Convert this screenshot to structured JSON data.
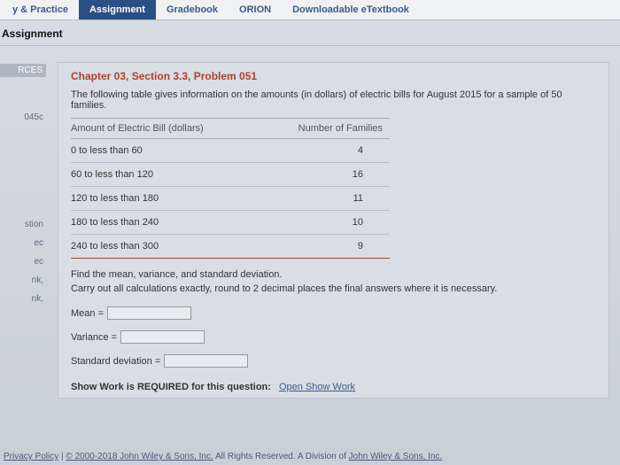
{
  "nav": {
    "items": [
      "y & Practice",
      "Assignment",
      "Gradebook",
      "ORION",
      "Downloadable eTextbook"
    ]
  },
  "page_header": "Assignment",
  "sidebar": {
    "rces": "RCES",
    "id": "045c",
    "stion": "stion",
    "ec": "ec",
    "nk": "nk,"
  },
  "problem": {
    "title": "Chapter 03, Section 3.3, Problem 051",
    "desc": "The following table gives information on the amounts (in dollars) of electric bills for August 2015 for a sample of 50 families.",
    "table": {
      "col1": "Amount of Electric Bill (dollars)",
      "col2": "Number of Families",
      "rows": [
        {
          "range": "0 to less than 60",
          "count": "4"
        },
        {
          "range": "60 to less than 120",
          "count": "16"
        },
        {
          "range": "120 to less than 180",
          "count": "11"
        },
        {
          "range": "180 to less than 240",
          "count": "10"
        },
        {
          "range": "240 to less than 300",
          "count": "9"
        }
      ]
    },
    "q1": "Find the mean, variance, and standard deviation.",
    "q2": "Carry out all calculations exactly, round to 2 decimal places the final answers where it is necessary.",
    "mean_label": "Mean =",
    "variance_label": "Variance =",
    "sd_label": "Standard deviation =",
    "showwork_bold": "Show Work is REQUIRED for this question:",
    "showwork_link": "Open Show Work"
  },
  "footer": {
    "privacy": "Privacy Policy",
    "sep": "  |  ",
    "copy": "© 2000-2018 John Wiley & Sons, Inc.",
    "rights": " All Rights Reserved. A Division of ",
    "co": "John Wiley & Sons, Inc."
  }
}
